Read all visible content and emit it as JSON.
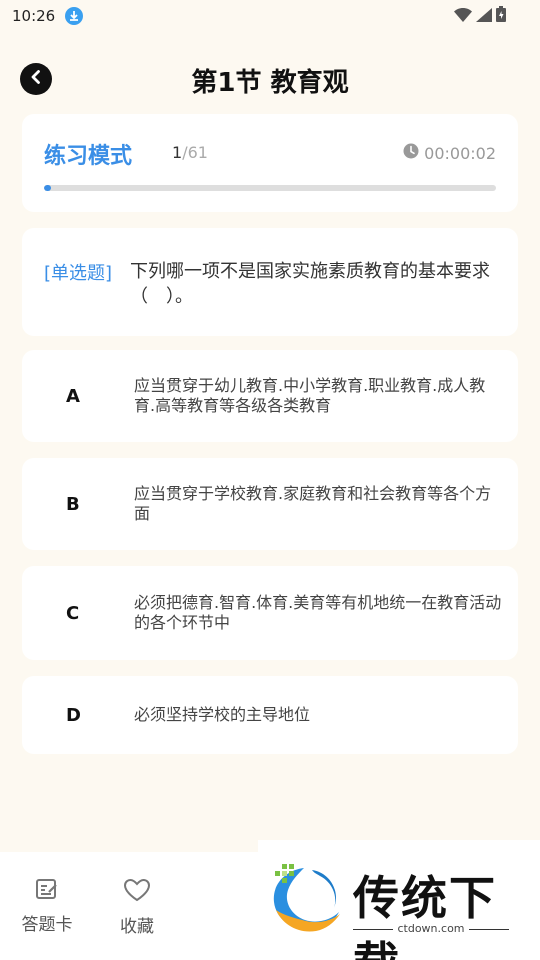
{
  "status_bar": {
    "time": "10:26"
  },
  "header": {
    "title": "第1节 教育观"
  },
  "mode": {
    "label": "练习模式",
    "current": "1",
    "total": "/61",
    "timer": "00:00:02",
    "progress_fraction": 0.016
  },
  "question": {
    "type": "[单选题]",
    "text": "下列哪一项不是国家实施素质教育的基本要求（　）。"
  },
  "options": [
    {
      "letter": "A",
      "text": "应当贯穿于幼儿教育.中小学教育.职业教育.成人教育.高等教育等各级各类教育"
    },
    {
      "letter": "B",
      "text": "应当贯穿于学校教育.家庭教育和社会教育等各个方面"
    },
    {
      "letter": "C",
      "text": "必须把德育.智育.体育.美育等有机地统一在教育活动的各个环节中"
    },
    {
      "letter": "D",
      "text": "必须坚持学校的主导地位"
    }
  ],
  "bottom_nav": {
    "answer_card": "答题卡",
    "favorite": "收藏"
  },
  "watermark": {
    "brand": "传统下载",
    "domain": "ctdown.com"
  },
  "colors": {
    "accent": "#3a8ee6",
    "background": "#fdf9f1"
  },
  "icons": [
    "download-icon",
    "wifi-icon",
    "signal-icon",
    "battery-icon",
    "back-icon",
    "clock-icon",
    "answer-card-icon",
    "heart-icon"
  ]
}
